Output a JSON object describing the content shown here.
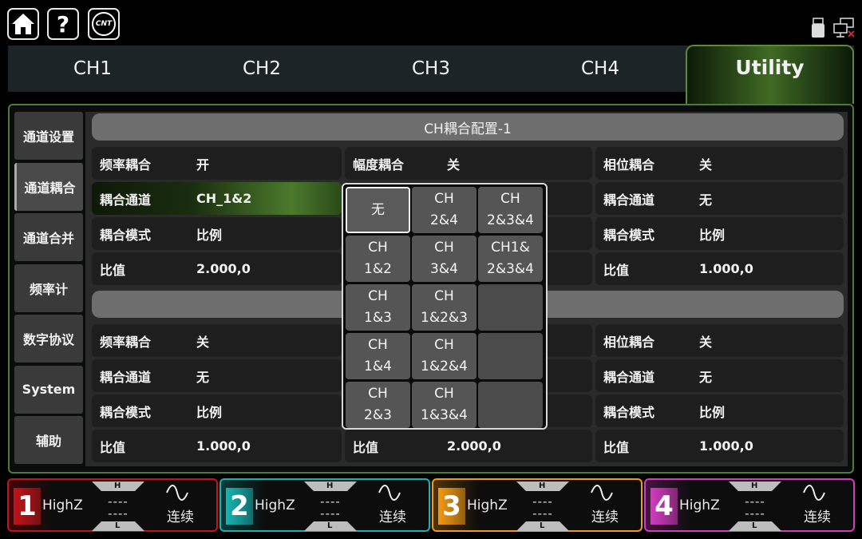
{
  "topbar": {
    "home_icon": "home-icon",
    "help_label": "?",
    "logo_text": "CNT"
  },
  "tabs": [
    "CH1",
    "CH2",
    "CH3",
    "CH4",
    "Utility"
  ],
  "active_tab": "Utility",
  "sidebar": [
    "通道设置",
    "通道耦合",
    "通道合并",
    "频率计",
    "数字协议",
    "System",
    "辅助"
  ],
  "active_sidebar": "通道耦合",
  "section1": {
    "title": "CH耦合配置-1",
    "col1": [
      {
        "label": "频率耦合",
        "value": "开"
      },
      {
        "label": "耦合通道",
        "value": "CH_1&2"
      },
      {
        "label": "耦合模式",
        "value": "比例"
      },
      {
        "label": "比值",
        "value": "2.000,0"
      }
    ],
    "col2": [
      {
        "label": "幅度耦合",
        "value": "关"
      }
    ],
    "col3": [
      {
        "label": "相位耦合",
        "value": "关"
      },
      {
        "label": "耦合通道",
        "value": "无"
      },
      {
        "label": "耦合模式",
        "value": "比例"
      },
      {
        "label": "比值",
        "value": "1.000,0"
      }
    ]
  },
  "section2": {
    "title": "",
    "col1": [
      {
        "label": "频率耦合",
        "value": "关"
      },
      {
        "label": "耦合通道",
        "value": "无"
      },
      {
        "label": "耦合模式",
        "value": "比例"
      },
      {
        "label": "比值",
        "value": "1.000,0"
      }
    ],
    "col2": [
      {
        "label": "比值",
        "value": "2.000,0"
      }
    ],
    "col3": [
      {
        "label": "相位耦合",
        "value": "关"
      },
      {
        "label": "耦合通道",
        "value": "无"
      },
      {
        "label": "耦合模式",
        "value": "比例"
      },
      {
        "label": "比值",
        "value": "1.000,0"
      }
    ]
  },
  "popup_options": [
    "无",
    "CH\n2&4",
    "CH\n2&3&4",
    "CH\n1&2",
    "CH\n3&4",
    "CH1&\n2&3&4",
    "CH\n1&3",
    "CH\n1&2&3",
    "",
    "CH\n1&4",
    "CH\n1&2&4",
    "",
    "CH\n2&3",
    "CH\n1&3&4",
    ""
  ],
  "popup_selected": "无",
  "channels": [
    {
      "num": "1",
      "mode": "HighZ",
      "h": "H",
      "l": "L",
      "dash1": "----",
      "dash2": "----",
      "output": "连续",
      "color": "#c0151a"
    },
    {
      "num": "2",
      "mode": "HighZ",
      "h": "H",
      "l": "L",
      "dash1": "----",
      "dash2": "----",
      "output": "连续",
      "color": "#18b3b0"
    },
    {
      "num": "3",
      "mode": "HighZ",
      "h": "H",
      "l": "L",
      "dash1": "----",
      "dash2": "----",
      "output": "连续",
      "color": "#f09a16"
    },
    {
      "num": "4",
      "mode": "HighZ",
      "h": "H",
      "l": "L",
      "dash1": "----",
      "dash2": "----",
      "output": "连续",
      "color": "#d23cbf"
    }
  ]
}
